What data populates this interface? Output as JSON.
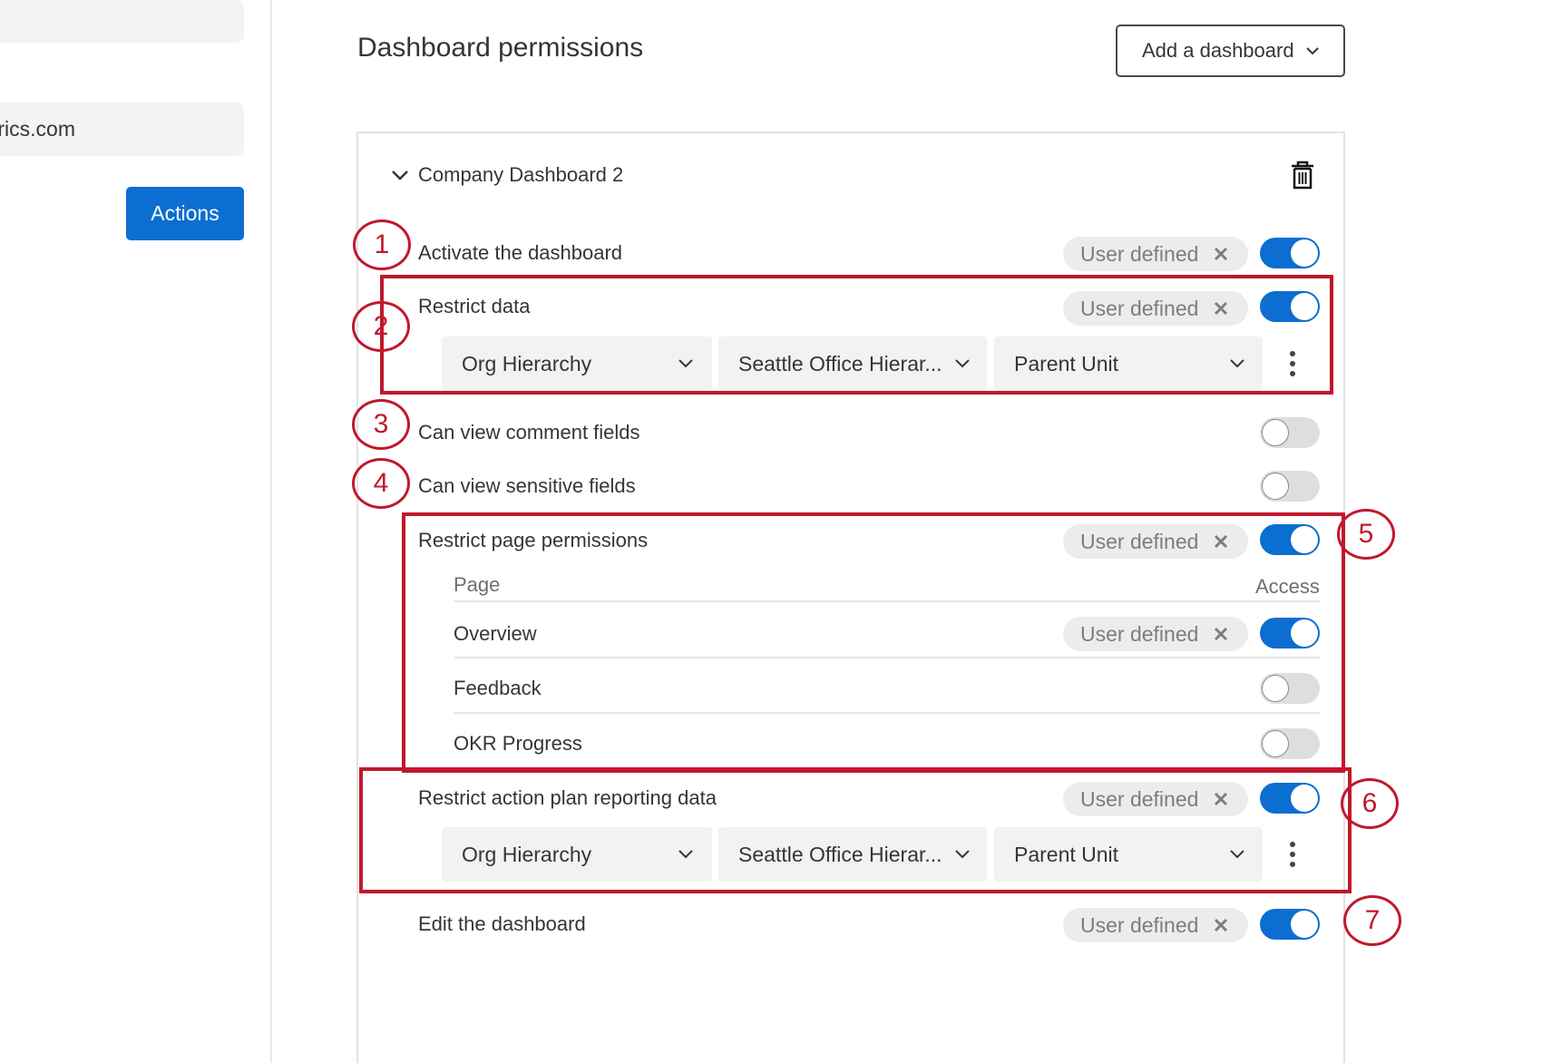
{
  "left_pane": {
    "email_fragment": "rics.com",
    "actions_label": "Actions"
  },
  "header": {
    "title": "Dashboard permissions",
    "add_dashboard_label": "Add a dashboard"
  },
  "dashboard": {
    "name": "Company Dashboard 2",
    "pill_label": "User defined",
    "rows": {
      "activate": {
        "label": "Activate the dashboard",
        "enabled": true
      },
      "restrict_data": {
        "label": "Restrict data",
        "enabled": true,
        "selects": [
          "Org Hierarchy",
          "Seattle Office Hierar...",
          "Parent Unit"
        ]
      },
      "comment_fields": {
        "label": "Can view comment fields",
        "enabled": false
      },
      "sensitive_fields": {
        "label": "Can view sensitive fields",
        "enabled": false
      },
      "page_permissions": {
        "label": "Restrict page permissions",
        "enabled": true,
        "col_page": "Page",
        "col_access": "Access",
        "pages": [
          {
            "label": "Overview",
            "enabled": true
          },
          {
            "label": "Feedback",
            "enabled": false
          },
          {
            "label": "OKR Progress",
            "enabled": false
          }
        ]
      },
      "action_plan": {
        "label": "Restrict action plan reporting data",
        "enabled": true,
        "selects": [
          "Org Hierarchy",
          "Seattle Office Hierar...",
          "Parent Unit"
        ]
      },
      "edit": {
        "label": "Edit the dashboard",
        "enabled": true
      }
    }
  },
  "annotations": [
    "1",
    "2",
    "3",
    "4",
    "5",
    "6",
    "7"
  ],
  "colors": {
    "accent": "#0b6ed0",
    "annotation": "#c0182c"
  }
}
